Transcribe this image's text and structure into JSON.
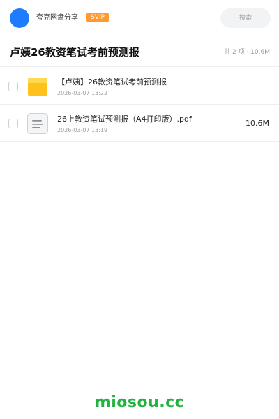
{
  "topbar": {
    "brand": "夸克网盘分享",
    "badge": "SVIP",
    "search_placeholder": "搜索"
  },
  "share": {
    "title": "卢姨26教资笔试考前预测报",
    "meta": "共 2 项 · 10.6M"
  },
  "files": [
    {
      "icon": "folder-icon",
      "name": "【卢姨】26教资笔试考前预测报",
      "time": "2026-03-07 13:22",
      "size": ""
    },
    {
      "icon": "document-icon",
      "name": "26上教资笔试预测报（A4打印版）.pdf",
      "time": "2026-03-07 13:19",
      "size": "10.6M"
    }
  ],
  "footer": {
    "watermark": "miosou.cc"
  },
  "colors": {
    "avatar": "#1f7bff",
    "svip_badge": "#ff9a2e",
    "folder": "#ffc21a",
    "watermark": "#22b33f"
  }
}
